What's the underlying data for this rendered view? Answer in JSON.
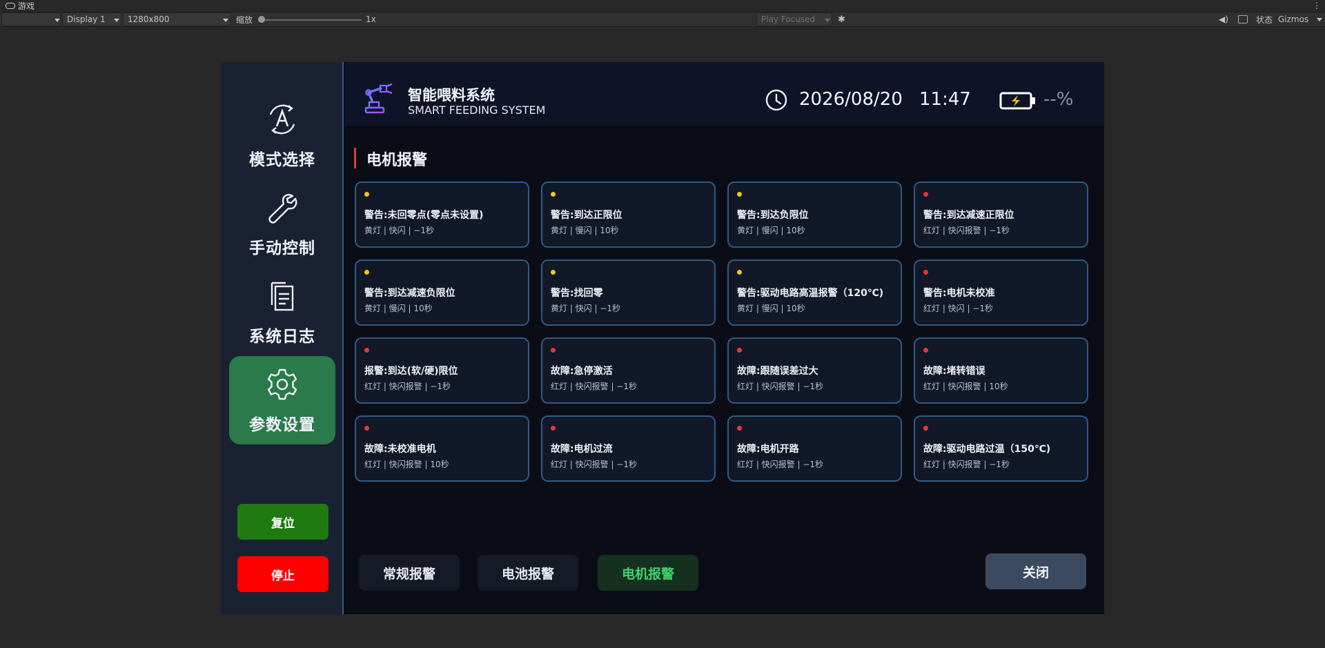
{
  "editor": {
    "tab_title": "游戏",
    "display": "Display 1",
    "resolution": "1280x800",
    "scale_label": "缩放",
    "scale_value": "1x",
    "play_mode": "Play Focused",
    "stats_label": "状态",
    "gizmos_label": "Gizmos"
  },
  "app": {
    "title": "智能喂料系统",
    "subtitle": "SMART FEEDING SYSTEM",
    "date": "2026/08/20",
    "time": "11:47",
    "battery": "--%"
  },
  "sidebar": {
    "items": [
      {
        "label": "模式选择",
        "icon": "auto-mode-icon"
      },
      {
        "label": "手动控制",
        "icon": "wrench-icon"
      },
      {
        "label": "系统日志",
        "icon": "document-icon"
      },
      {
        "label": "参数设置",
        "icon": "gear-icon",
        "active": true
      }
    ],
    "reset_label": "复位",
    "stop_label": "停止"
  },
  "section": {
    "title": "电机报警"
  },
  "colors": {
    "yellow": "#f5c518",
    "red": "#e53939",
    "active_nav": "#2a7a4a"
  },
  "alarms": [
    {
      "title": "警告:未回零点(零点未设置)",
      "meta": "黄灯 | 快闪 | −1秒",
      "level": "yellow"
    },
    {
      "title": "警告:到达正限位",
      "meta": "黄灯 | 慢闪 | 10秒",
      "level": "yellow"
    },
    {
      "title": "警告:到达负限位",
      "meta": "黄灯 | 慢闪 | 10秒",
      "level": "yellow"
    },
    {
      "title": "警告:到达减速正限位",
      "meta": "红灯 | 快闪报警 | −1秒",
      "level": "red"
    },
    {
      "title": "警告:到达减速负限位",
      "meta": "黄灯 | 慢闪 | 10秒",
      "level": "yellow"
    },
    {
      "title": "警告:找回零",
      "meta": "黄灯 | 快闪 | −1秒",
      "level": "yellow"
    },
    {
      "title": "警告:驱动电路高温报警（120℃)",
      "meta": "黄灯 | 慢闪 | 10秒",
      "level": "yellow"
    },
    {
      "title": "警告:电机未校准",
      "meta": "红灯 | 快闪 | −1秒",
      "level": "red"
    },
    {
      "title": "报警:到达(软/硬)限位",
      "meta": "红灯 | 快闪报警 | −1秒",
      "level": "red"
    },
    {
      "title": "故障:急停激活",
      "meta": "红灯 | 快闪报警 | −1秒",
      "level": "red"
    },
    {
      "title": "故障:跟随误差过大",
      "meta": "红灯 | 快闪报警 | −1秒",
      "level": "red"
    },
    {
      "title": "故障:堵转错误",
      "meta": "红灯 | 快闪报警 | 10秒",
      "level": "red"
    },
    {
      "title": "故障:未校准电机",
      "meta": "红灯 | 快闪报警 | 10秒",
      "level": "red"
    },
    {
      "title": "故障:电机过流",
      "meta": "红灯 | 快闪报警 | −1秒",
      "level": "red"
    },
    {
      "title": "故障:电机开路",
      "meta": "红灯 | 快闪报警 | −1秒",
      "level": "red"
    },
    {
      "title": "故障:驱动电路过温（150℃)",
      "meta": "红灯 | 快闪报警 | −1秒",
      "level": "red"
    }
  ],
  "tabs": [
    {
      "label": "常规报警"
    },
    {
      "label": "电池报警"
    },
    {
      "label": "电机报警",
      "active": true
    }
  ],
  "close_label": "关闭"
}
